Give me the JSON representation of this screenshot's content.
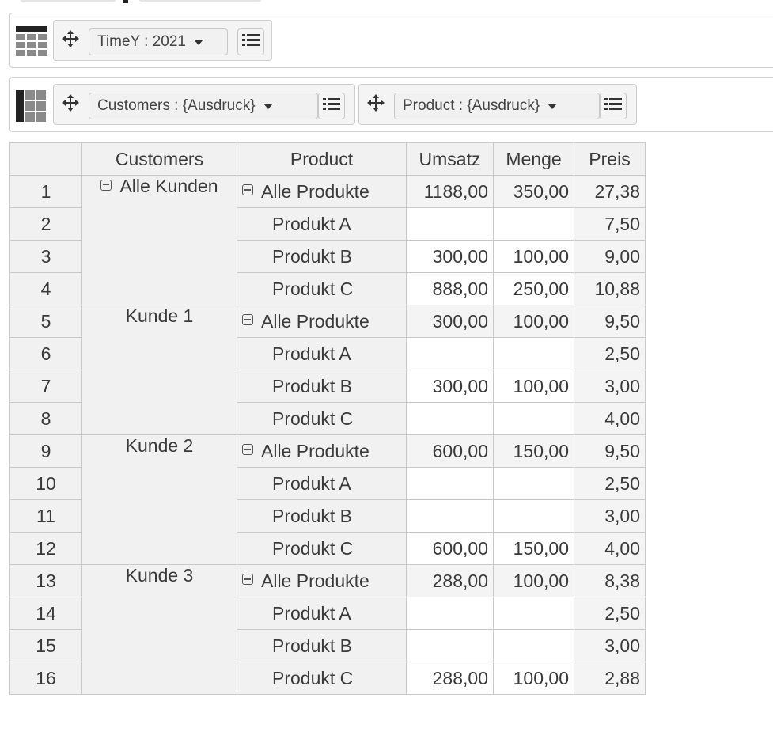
{
  "filter_zone": {
    "icon": "table-filter-icon",
    "filters": [
      {
        "label": "TimeY : 2021"
      }
    ]
  },
  "row_zone": {
    "icon": "row-layout-icon",
    "fields": [
      {
        "label": "Customers : {Ausdruck}"
      },
      {
        "label": "Product : {Ausdruck}"
      }
    ]
  },
  "table": {
    "headers": [
      "",
      "Customers",
      "Product",
      "Umsatz",
      "Menge",
      "Preis"
    ],
    "groups": [
      {
        "customer": "Alle Kunden",
        "collapsible": true,
        "rows": [
          {
            "n": "1",
            "product": "Alle Produkte",
            "total": true,
            "umsatz": "1188,00",
            "menge": "350,00",
            "preis": "27,38"
          },
          {
            "n": "2",
            "product": "Produkt A",
            "total": false,
            "umsatz": "",
            "menge": "",
            "preis": "7,50"
          },
          {
            "n": "3",
            "product": "Produkt B",
            "total": false,
            "umsatz": "300,00",
            "menge": "100,00",
            "preis": "9,00"
          },
          {
            "n": "4",
            "product": "Produkt C",
            "total": false,
            "umsatz": "888,00",
            "menge": "250,00",
            "preis": "10,88"
          }
        ]
      },
      {
        "customer": "Kunde 1",
        "collapsible": false,
        "rows": [
          {
            "n": "5",
            "product": "Alle Produkte",
            "total": true,
            "umsatz": "300,00",
            "menge": "100,00",
            "preis": "9,50"
          },
          {
            "n": "6",
            "product": "Produkt A",
            "total": false,
            "umsatz": "",
            "menge": "",
            "preis": "2,50"
          },
          {
            "n": "7",
            "product": "Produkt B",
            "total": false,
            "umsatz": "300,00",
            "menge": "100,00",
            "preis": "3,00"
          },
          {
            "n": "8",
            "product": "Produkt C",
            "total": false,
            "umsatz": "",
            "menge": "",
            "preis": "4,00"
          }
        ]
      },
      {
        "customer": "Kunde 2",
        "collapsible": false,
        "rows": [
          {
            "n": "9",
            "product": "Alle Produkte",
            "total": true,
            "umsatz": "600,00",
            "menge": "150,00",
            "preis": "9,50"
          },
          {
            "n": "10",
            "product": "Produkt A",
            "total": false,
            "umsatz": "",
            "menge": "",
            "preis": "2,50"
          },
          {
            "n": "11",
            "product": "Produkt B",
            "total": false,
            "umsatz": "",
            "menge": "",
            "preis": "3,00"
          },
          {
            "n": "12",
            "product": "Produkt C",
            "total": false,
            "umsatz": "600,00",
            "menge": "150,00",
            "preis": "4,00"
          }
        ]
      },
      {
        "customer": "Kunde 3",
        "collapsible": false,
        "rows": [
          {
            "n": "13",
            "product": "Alle Produkte",
            "total": true,
            "umsatz": "288,00",
            "menge": "100,00",
            "preis": "8,38"
          },
          {
            "n": "14",
            "product": "Produkt A",
            "total": false,
            "umsatz": "",
            "menge": "",
            "preis": "2,50"
          },
          {
            "n": "15",
            "product": "Produkt B",
            "total": false,
            "umsatz": "",
            "menge": "",
            "preis": "3,00"
          },
          {
            "n": "16",
            "product": "Produkt C",
            "total": false,
            "umsatz": "288,00",
            "menge": "100,00",
            "preis": "2,88"
          }
        ]
      }
    ]
  }
}
